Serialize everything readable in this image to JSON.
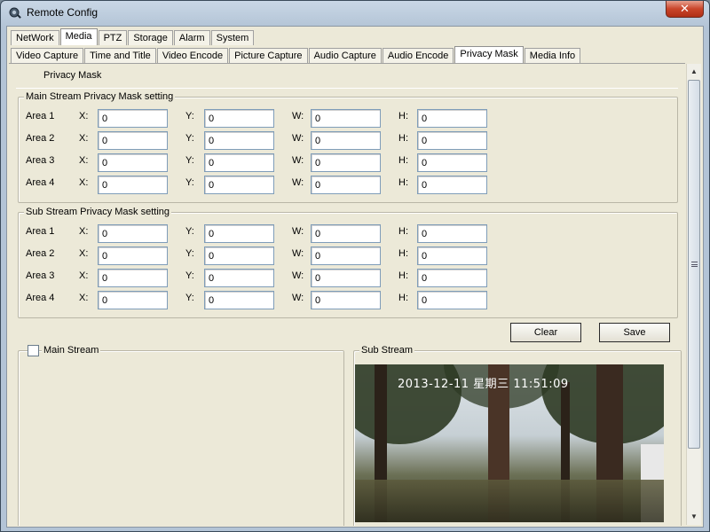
{
  "window": {
    "title": "Remote Config",
    "close_glyph": "✕",
    "icon": "camera-config-icon"
  },
  "tabs_main": [
    {
      "label": "NetWork",
      "active": false
    },
    {
      "label": "Media",
      "active": true
    },
    {
      "label": "PTZ",
      "active": false
    },
    {
      "label": "Storage",
      "active": false
    },
    {
      "label": "Alarm",
      "active": false
    },
    {
      "label": "System",
      "active": false
    }
  ],
  "tabs_media": [
    {
      "label": "Video Capture",
      "active": false
    },
    {
      "label": "Time and Title",
      "active": false
    },
    {
      "label": "Video Encode",
      "active": false
    },
    {
      "label": "Picture Capture",
      "active": false
    },
    {
      "label": "Audio Capture",
      "active": false
    },
    {
      "label": "Audio Encode",
      "active": false
    },
    {
      "label": "Privacy Mask",
      "active": true
    },
    {
      "label": "Media Info",
      "active": false
    }
  ],
  "pane": {
    "title": "Privacy Mask"
  },
  "labels": {
    "x": "X:",
    "y": "Y:",
    "w": "W:",
    "h": "H:"
  },
  "main_stream_group": {
    "title": "Main Stream Privacy Mask setting",
    "areas": [
      {
        "name": "Area 1",
        "x": "0",
        "y": "0",
        "w": "0",
        "h": "0"
      },
      {
        "name": "Area 2",
        "x": "0",
        "y": "0",
        "w": "0",
        "h": "0"
      },
      {
        "name": "Area 3",
        "x": "0",
        "y": "0",
        "w": "0",
        "h": "0"
      },
      {
        "name": "Area 4",
        "x": "0",
        "y": "0",
        "w": "0",
        "h": "0"
      }
    ]
  },
  "sub_stream_group": {
    "title": "Sub Stream Privacy Mask setting",
    "areas": [
      {
        "name": "Area 1",
        "x": "0",
        "y": "0",
        "w": "0",
        "h": "0"
      },
      {
        "name": "Area 2",
        "x": "0",
        "y": "0",
        "w": "0",
        "h": "0"
      },
      {
        "name": "Area 3",
        "x": "0",
        "y": "0",
        "w": "0",
        "h": "0"
      },
      {
        "name": "Area 4",
        "x": "0",
        "y": "0",
        "w": "0",
        "h": "0"
      }
    ]
  },
  "buttons": {
    "clear": "Clear",
    "save": "Save"
  },
  "main_stream_preview": {
    "label": "Main Stream",
    "checked": false
  },
  "sub_stream_preview": {
    "label": "Sub Stream",
    "overlay_text": "2013-12-11 星期三 11:51:09"
  },
  "colors": {
    "active_tab": "#ffffff",
    "panel_bg": "#ece9d8",
    "close_button": "#c9452a"
  }
}
